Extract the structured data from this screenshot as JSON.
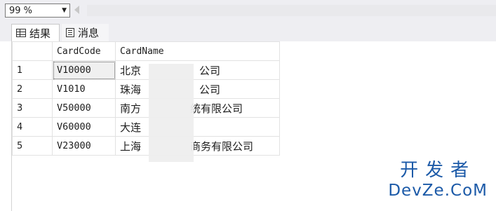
{
  "zoom": {
    "value": "99 %"
  },
  "tabs": [
    {
      "label": "结果",
      "icon": "grid-icon",
      "active": true
    },
    {
      "label": "消息",
      "icon": "messages-icon",
      "active": false
    }
  ],
  "table": {
    "headers": [
      "",
      "CardCode",
      "CardName"
    ],
    "rows": [
      {
        "num": "1",
        "code": "V10000",
        "name_left": "北京",
        "name_right": "公司"
      },
      {
        "num": "2",
        "code": "V1010",
        "name_left": "珠海",
        "name_right": "公司"
      },
      {
        "num": "3",
        "code": "V50000",
        "name_left": "南方",
        "name_right": "统有限公司"
      },
      {
        "num": "4",
        "code": "V60000",
        "name_left": "大连",
        "name_right": ""
      },
      {
        "num": "5",
        "code": "V23000",
        "name_left": "上海",
        "name_right": "商务有限公司"
      }
    ]
  },
  "watermark": {
    "cn": "开发者",
    "en": "DevZe.CoM"
  }
}
